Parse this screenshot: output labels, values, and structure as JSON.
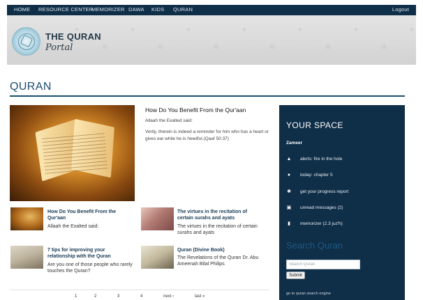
{
  "nav": {
    "items": [
      "HOME",
      "RESOURCE CENTER",
      "MEMORIZER",
      "DAWA",
      "KIDS",
      "QURAN"
    ],
    "logout": "Logout"
  },
  "logo": {
    "title": "THE QURAN",
    "subtitle": "Portal"
  },
  "page": {
    "title": "QURAN"
  },
  "featured": {
    "title": "How Do You Benefit From the Qur'aan",
    "line1": "Allaah the Exalted said:",
    "body": "Verily, therein is indeed a reminder for him who has a heart or gives ear while he is heedful.(Qaaf 50:37)"
  },
  "articles": [
    {
      "title": "How Do You Benefit From the Qur'aan",
      "text": "Allaah the Exalted said:"
    },
    {
      "title": "The virtues in the recitation of certain surahs and ayats",
      "text": "The virtues in the recitation of certain surahs and ayats"
    },
    {
      "title": "7 tips for improving your relationship with the Quran",
      "text": "Are you one of those people who rarely touches the Quran?"
    },
    {
      "title": "Quran (Divine Book)",
      "text": "The Revelations of the Quran Dr. Abu Ameenah Bilal Philips"
    }
  ],
  "pagination": {
    "pages": [
      "1",
      "2",
      "3",
      "4"
    ],
    "next": "next ›",
    "last": "last »"
  },
  "sidebar": {
    "title": "YOUR SPACE",
    "user": "Zameer",
    "items": [
      {
        "icon": "bell-icon",
        "label": "alerts: fire in the hole"
      },
      {
        "icon": "pin-icon",
        "label": "today: chapter 5"
      },
      {
        "icon": "wrench-icon",
        "label": "get your progress report"
      },
      {
        "icon": "mail-icon",
        "label": "unread messages (2)"
      },
      {
        "icon": "bookmark-icon",
        "label": "memorizer (2.3 juz'h)"
      }
    ],
    "search_title": "Search Quran",
    "search_placeholder": "Search Quran",
    "submit": "Submit",
    "search_engine_link": "go to quran search engine"
  }
}
